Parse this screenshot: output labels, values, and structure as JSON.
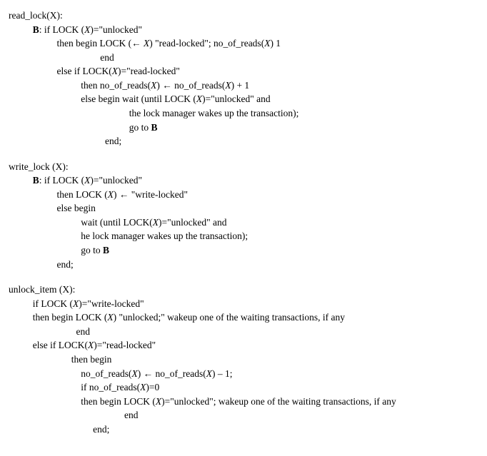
{
  "read_lock": {
    "header": "read_lock(X):",
    "l1a": "B",
    "l1b": ": if LOCK (",
    "l1c": "X",
    "l1d": ")=\"unlocked\"",
    "l2a": "then begin LOCK (← ",
    "l2b": "X",
    "l2c": ") \"read-locked\"; no_of_reads(",
    "l2d": "X",
    "l2e": ") 1",
    "l3": "end",
    "l4a": "else if LOCK(",
    "l4b": "X",
    "l4c": ")=\"read-locked\"",
    "l5a": "then no_of_reads(",
    "l5b": "X",
    "l5c": ") ← no_of_reads(",
    "l5d": "X",
    "l5e": ") + 1",
    "l6a": "else begin wait (until LOCK (",
    "l6b": "X",
    "l6c": ")=\"unlocked\" and",
    "l7": "the lock manager wakes up the transaction);",
    "l8a": "go to ",
    "l8b": "B",
    "l9": "end;"
  },
  "write_lock": {
    "header": "write_lock (X):",
    "l1a": "B",
    "l1b": ": if LOCK (",
    "l1c": "X",
    "l1d": ")=\"unlocked\"",
    "l2a": "then LOCK (",
    "l2b": "X",
    "l2c": ") ← \"write-locked\"",
    "l3": "else begin",
    "l4a": "wait (until LOCK(",
    "l4b": "X",
    "l4c": ")=\"unlocked\" and",
    "l5": "he lock manager wakes up the transaction);",
    "l6a": "go to ",
    "l6b": "B",
    "l7": "end;"
  },
  "unlock_item": {
    "header": "unlock_item (X):",
    "l1a": "if LOCK (",
    "l1b": "X",
    "l1c": ")=\"write-locked\"",
    "l2a": "then begin LOCK (",
    "l2b": "X",
    "l2c": ") \"unlocked;\" wakeup one of the waiting transactions, if any",
    "l3": "end",
    "l4a": "else if LOCK(",
    "l4b": "X",
    "l4c": ")=\"read-locked\"",
    "l5": "then begin",
    "l6a": "no_of_reads(",
    "l6b": "X",
    "l6c": ") ← no_of_reads(",
    "l6d": "X",
    "l6e": ") – 1;",
    "l7a": "if no_of_reads(",
    "l7b": "X",
    "l7c": ")=0",
    "l8a": "then begin LOCK (",
    "l8b": "X",
    "l8c": ")=\"unlocked\"; wakeup one of the waiting transactions, if any",
    "l9": "end",
    "l10": "end;"
  }
}
